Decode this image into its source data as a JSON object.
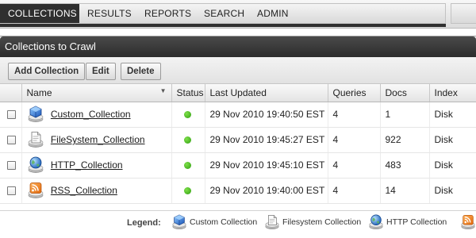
{
  "nav": {
    "tabs": [
      "COLLECTIONS",
      "RESULTS",
      "REPORTS",
      "SEARCH",
      "ADMIN"
    ],
    "active": "COLLECTIONS"
  },
  "panel": {
    "title": "Collections to Crawl",
    "buttons": {
      "add": "Add Collection",
      "edit": "Edit",
      "delete": "Delete"
    }
  },
  "table": {
    "headers": [
      "Name",
      "Status",
      "Last Updated",
      "Queries",
      "Docs",
      "Index"
    ],
    "rows": [
      {
        "name": "Custom_Collection",
        "icon": "custom-collection-icon",
        "status": "green",
        "last_updated": "29 Nov 2010 19:40:50 EST",
        "queries": "4",
        "docs": "1",
        "index": "Disk"
      },
      {
        "name": "FileSystem_Collection",
        "icon": "filesystem-collection-icon",
        "status": "green",
        "last_updated": "29 Nov 2010 19:45:27 EST",
        "queries": "4",
        "docs": "922",
        "index": "Disk"
      },
      {
        "name": "HTTP_Collection",
        "icon": "http-collection-icon",
        "status": "green",
        "last_updated": "29 Nov 2010 19:45:10 EST",
        "queries": "4",
        "docs": "483",
        "index": "Disk"
      },
      {
        "name": "RSS_Collection",
        "icon": "rss-collection-icon",
        "status": "green",
        "last_updated": "29 Nov 2010 19:40:00 EST",
        "queries": "4",
        "docs": "14",
        "index": "Disk"
      }
    ]
  },
  "legend": {
    "label": "Legend:",
    "items": [
      "Custom Collection",
      "Filesystem Collection",
      "HTTP Collection"
    ]
  },
  "colors": {
    "nav_active": "#2f2f2f",
    "header_bar": "#333333",
    "status_ok": "#3db31b"
  }
}
